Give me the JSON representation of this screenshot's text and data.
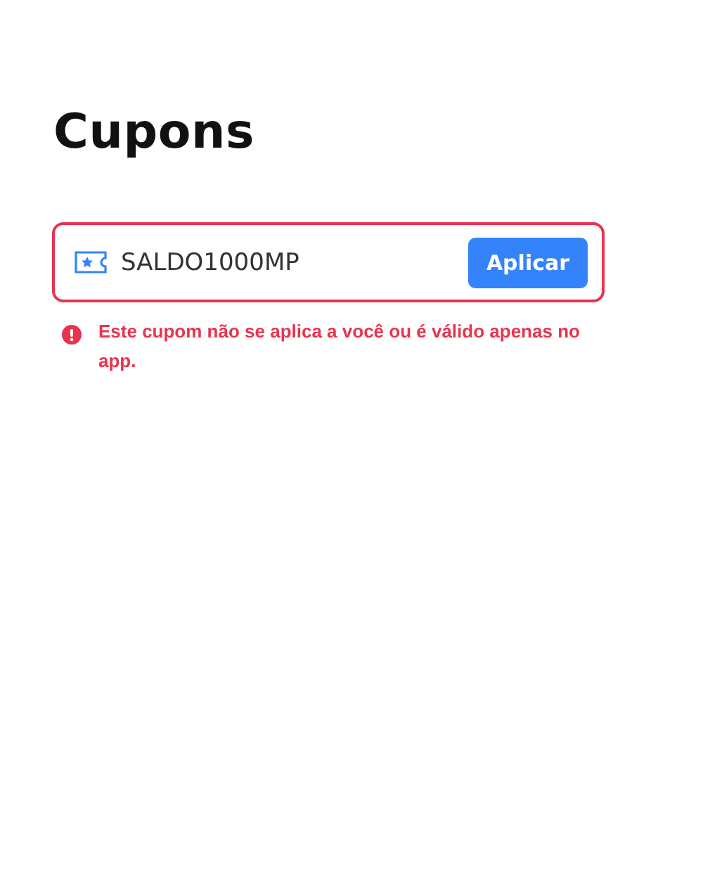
{
  "title": "Cupons",
  "coupon_field": {
    "value": "SALDO1000MP",
    "invalid": true
  },
  "apply_button": {
    "label": "Aplicar"
  },
  "error_message": "Este cupom não se aplica a você ou é válido apenas no app."
}
